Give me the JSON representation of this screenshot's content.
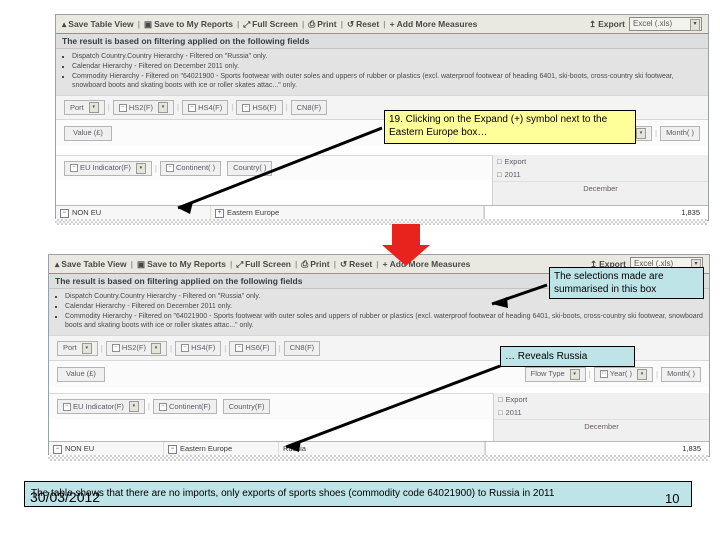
{
  "slide": {
    "date_stamp": "30/03/2012",
    "page_number": "10",
    "caption": "The table shows that there are no imports, only exports of sports shoes (commodity code 64021900) to Russia in 2011"
  },
  "callouts": {
    "step_note": "19. Clicking on the Expand (+) symbol next to the Eastern Europe box…",
    "summary_note": "The selections made are summarised in this box",
    "reveals_note": "… Reveals Russia"
  },
  "toolbar": {
    "save_table_view": "Save Table View",
    "save_to_my_reports": "Save to My Reports",
    "full_screen": "Full Screen",
    "print": "Print",
    "reset": "Reset",
    "add_more_measures": "Add More Measures",
    "export": "Export",
    "export_format": "Excel (.xls)",
    "separator": "|"
  },
  "filter_summary": {
    "heading": "The result is based on filtering applied on the following fields",
    "items": [
      "Dispatch Country.Country Hierarchy - Filtered on \"Russia\" only.",
      "Calendar Hierarchy - Filtered on December 2011 only.",
      "Commodity Hierarchy - Filtered on \"64021900 - Sports footwear with outer soles and uppers of rubber or plastics (excl. waterproof footwear of heading 6401, ski-boots, cross-country ski footwear, snowboard boots and skating boots with ice or roller skates attac...\" only."
    ]
  },
  "dimension_bar": {
    "port": "Port",
    "hs2": "HS2(F)",
    "hs4": "HS4(F)",
    "hs6": "HS6(F)",
    "cn8": "CN8(F)"
  },
  "measure_bar": {
    "value": "Value (£)",
    "flow_type": "Flow Type",
    "year": "Year( )",
    "month": "Month( )"
  },
  "geo_bar": {
    "eu_indicator": "EU Indicator(F)",
    "continent_top": "Continent( )",
    "country_top": "Country( )",
    "continent_bottom": "Continent(F)",
    "country_bottom": "Country(F)"
  },
  "column_tree": {
    "flow": "Export",
    "year": "2011",
    "month": "December"
  },
  "table_top": {
    "eu_indicator_cell": "NON EU",
    "continent_cell": "Eastern Europe",
    "value_cell": "1,835"
  },
  "table_bottom": {
    "eu_indicator_cell": "NON EU",
    "continent_cell": "Eastern Europe",
    "country_cell": "Russia",
    "value_cell": "1,835"
  },
  "icons": {
    "expand_plus": "+",
    "collapse_minus": "−",
    "caret_down": "▾",
    "checkbox": "□",
    "save_icon": "▲",
    "disk_icon": "☒",
    "fullscreen_icon": "⤢",
    "print_icon": "⎙",
    "reset_icon": "↺",
    "add_icon": "+",
    "export_icon": "↥"
  },
  "colors": {
    "callout_yellow": "#ffff99",
    "callout_cyan": "#bfe4e8",
    "arrow_red": "#e8221c",
    "toolbar_bg": "#e9e9e1"
  }
}
